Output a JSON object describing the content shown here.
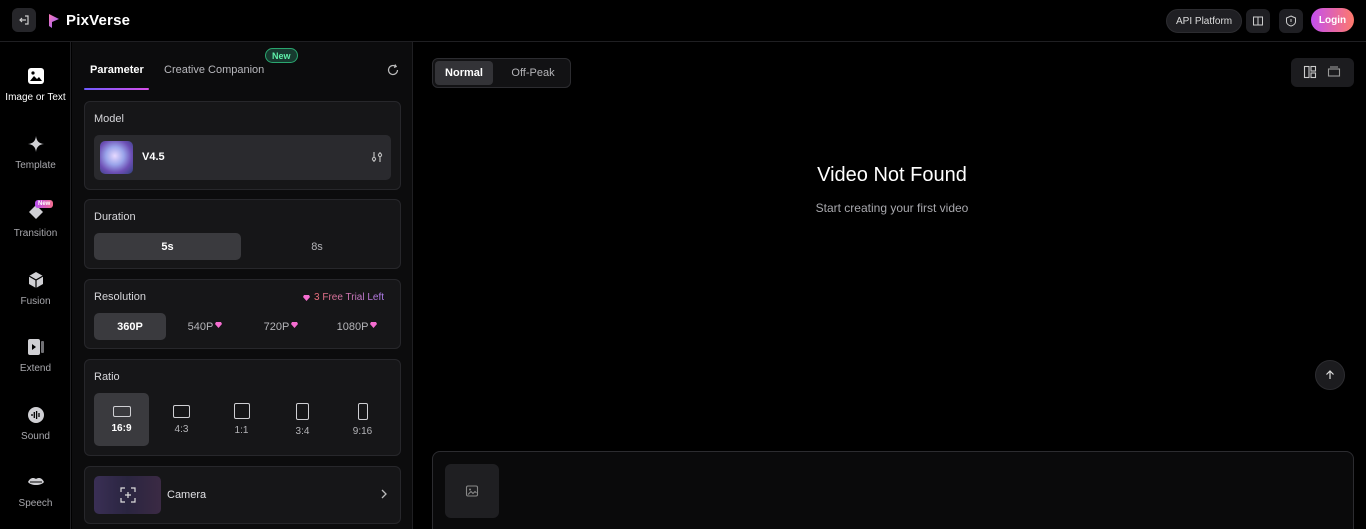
{
  "header": {
    "brand": "PixVerse",
    "api_platform": "API Platform",
    "login": "Login"
  },
  "nav": {
    "items": [
      {
        "label": "Image or Text",
        "icon": "image-icon",
        "active": true
      },
      {
        "label": "Template",
        "icon": "sparkle-icon"
      },
      {
        "label": "Transition",
        "icon": "diamond-icon",
        "badge": "New"
      },
      {
        "label": "Fusion",
        "icon": "cube-icon"
      },
      {
        "label": "Extend",
        "icon": "extend-icon"
      },
      {
        "label": "Sound",
        "icon": "sound-icon"
      },
      {
        "label": "Speech",
        "icon": "lips-icon"
      }
    ]
  },
  "panel": {
    "tabs": {
      "parameter": "Parameter",
      "creative_companion": "Creative Companion",
      "new_badge": "New"
    },
    "model": {
      "title": "Model",
      "value": "V4.5"
    },
    "duration": {
      "title": "Duration",
      "options": [
        "5s",
        "8s"
      ],
      "selected": "5s"
    },
    "resolution": {
      "title": "Resolution",
      "trial": "3 Free Trial Left",
      "options": [
        "360P",
        "540P",
        "720P",
        "1080P"
      ],
      "selected": "360P"
    },
    "ratio": {
      "title": "Ratio",
      "options": [
        "16:9",
        "4:3",
        "1:1",
        "3:4",
        "9:16"
      ],
      "selected": "16:9"
    },
    "camera": {
      "label": "Camera"
    }
  },
  "main": {
    "modes": {
      "normal": "Normal",
      "off_peak": "Off-Peak"
    },
    "empty_title": "Video Not Found",
    "empty_subtitle": "Start creating your first video"
  },
  "colors": {
    "accent_gradient_start": "#c34ef0",
    "accent_gradient_end": "#ff7a6b",
    "new_badge_green": "#5ff0a9",
    "gem_pink": "#f56dd0"
  }
}
